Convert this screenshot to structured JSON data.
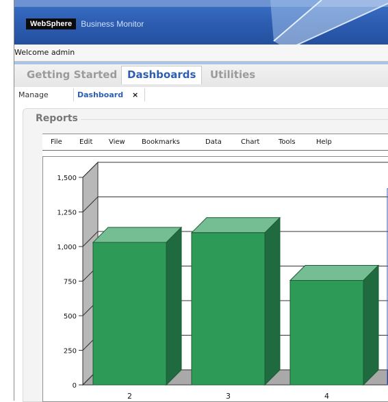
{
  "banner": {
    "brand_box": "WebSphere",
    "product": "Business Monitor"
  },
  "welcome": {
    "text": "Welcome admin"
  },
  "top_tabs": [
    {
      "label": "Getting Started",
      "active": false
    },
    {
      "label": "Dashboards",
      "active": true
    },
    {
      "label": "Utilities",
      "active": false
    }
  ],
  "sub_tabs": {
    "manage": "Manage",
    "dashboard": "Dashboard",
    "close": "×"
  },
  "panel": {
    "title": "Reports"
  },
  "menu": [
    "File",
    "Edit",
    "View",
    "Bookmarks",
    "Data",
    "Chart",
    "Tools",
    "Help"
  ],
  "colors": {
    "banner": "#2e5fb4",
    "bar_front": "#2e9a57",
    "bar_top": "#75bd93",
    "bar_side": "#1f6a3e",
    "active_tab": "#2d5fb1"
  },
  "chart_data": {
    "type": "bar",
    "style": "3d",
    "categories": [
      "2",
      "3",
      "4"
    ],
    "values": [
      1030,
      1100,
      755
    ],
    "ylim": [
      0,
      1500
    ],
    "yticks": [
      0,
      250,
      500,
      750,
      1000,
      1250,
      1500
    ],
    "ytick_labels": [
      "0",
      "250",
      "500",
      "750",
      "1,000",
      "1,250",
      "1,500"
    ],
    "partial_next_value": 1270,
    "grid": true
  }
}
